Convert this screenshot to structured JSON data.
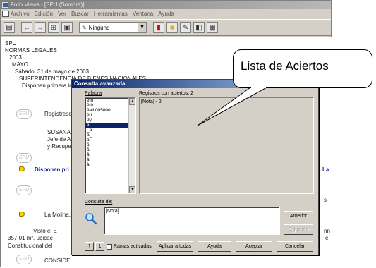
{
  "window": {
    "title": "Folio Views - [SPU (Sombra)]",
    "menu": [
      "Archivo",
      "Edición",
      "Ver",
      "Buscar",
      "Herramientas",
      "Ventana",
      "Ayuda"
    ]
  },
  "toolbar": {
    "combo_value": "Ninguno"
  },
  "document": {
    "tree": [
      "SPU",
      "NORMAS LEGALES",
      "2003",
      "MAYO",
      "Sábado, 31 de mayo de 2003",
      "SUPERINTENDENCIA DE BIENES NACIONALES"
    ],
    "summary_line": "Disponen primera inscripción de dominio a favor de Estado de terreno ubicado en el distrito de Punta, Provincia C",
    "body": [
      "Regístrese",
      "SUSANA I",
      "Jefe de Ad",
      "y Recuper",
      "Disponen pri",
      "La Molina,",
      "Visto el E",
      "357,01 m², ubicac",
      "Constitucional del",
      "CONSIDE"
    ],
    "right_fragments": [
      "La",
      "s",
      "nn",
      "el"
    ],
    "seal_text": "SPU"
  },
  "dialog": {
    "title": "Consulta avanzada",
    "close": "×",
    "words_label": "Palabra",
    "results_label": "Registros con aciertos: 2",
    "word_list": [
      "9th",
      "9.ü",
      "9all.005000",
      "9ü",
      "9y",
      "a",
      "_a",
      "a_",
      "ä",
      "ä",
      "ã",
      "â",
      "á",
      "à"
    ],
    "selected_index": 5,
    "results": [
      "[Nota] - 2"
    ],
    "query_label": "Consulta de:",
    "query_value": "[Nota]",
    "buttons": {
      "previous": "Anterior",
      "next": "Siguiente",
      "branches": "Ramas activadas",
      "apply_all": "Aplicar a todas",
      "help": "Ayuda",
      "accept": "Aceptar",
      "cancel": "Cancelar"
    }
  },
  "callout": {
    "text": "Lista de Aciertos"
  }
}
